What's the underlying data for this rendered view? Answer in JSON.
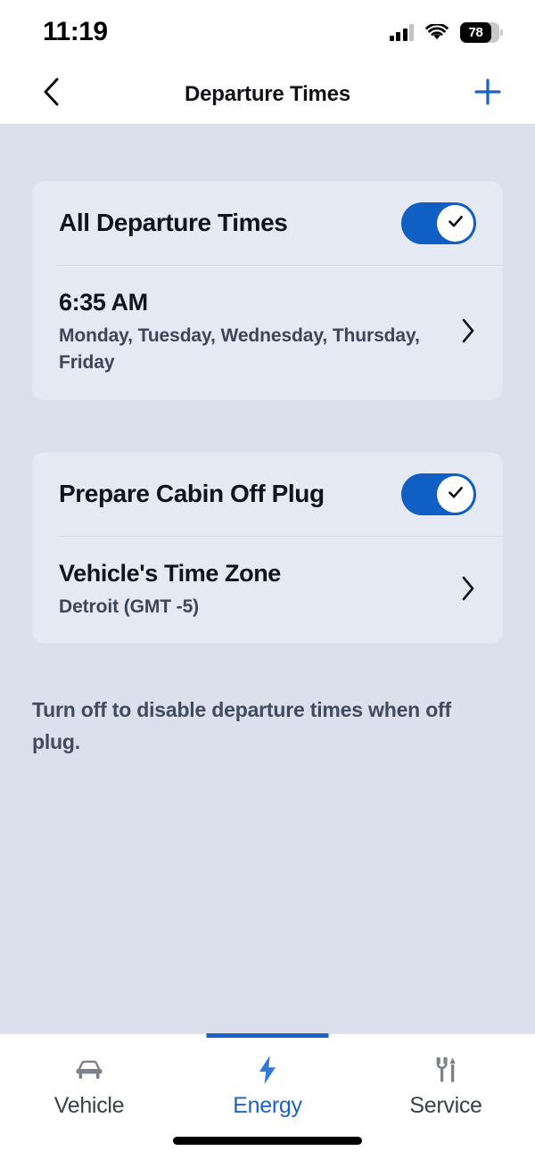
{
  "status_bar": {
    "time": "11:19",
    "cellular_icon": "cellular-bars-icon",
    "wifi_icon": "wifi-icon",
    "battery_percent": "78",
    "battery_icon": "battery-icon"
  },
  "nav": {
    "title": "Departure Times",
    "back_icon": "chevron-left-icon",
    "add_icon": "plus-icon",
    "accent_color": "#1a62c4"
  },
  "cards": [
    {
      "id": "departure-times",
      "toggle_row": {
        "label": "All Departure Times",
        "toggle_on": true,
        "toggle_icon": "check-icon"
      },
      "nav_row": {
        "title": "6:35 AM",
        "subtitle": "Monday, Tuesday, Wednesday, Thursday, Friday",
        "chevron_icon": "chevron-right-icon"
      }
    },
    {
      "id": "prepare-cabin",
      "toggle_row": {
        "label": "Prepare Cabin Off Plug",
        "toggle_on": true,
        "toggle_icon": "check-icon"
      },
      "nav_row": {
        "title": "Vehicle's Time Zone",
        "subtitle": "Detroit (GMT -5)",
        "chevron_icon": "chevron-right-icon"
      }
    }
  ],
  "helper_text": "Turn off to disable departure times when off plug.",
  "tabs": [
    {
      "label": "Vehicle",
      "icon": "car-icon",
      "active": false
    },
    {
      "label": "Energy",
      "icon": "lightning-bolt-icon",
      "active": true
    },
    {
      "label": "Service",
      "icon": "wrench-screwdriver-icon",
      "active": true
    }
  ],
  "theme": {
    "background": "#dbe0ec",
    "card_background": "#e5e9f3",
    "accent": "#1a62c4",
    "toggle_on_color": "#0f5fc4",
    "text_primary": "#10141c",
    "text_secondary": "#3c4656"
  }
}
